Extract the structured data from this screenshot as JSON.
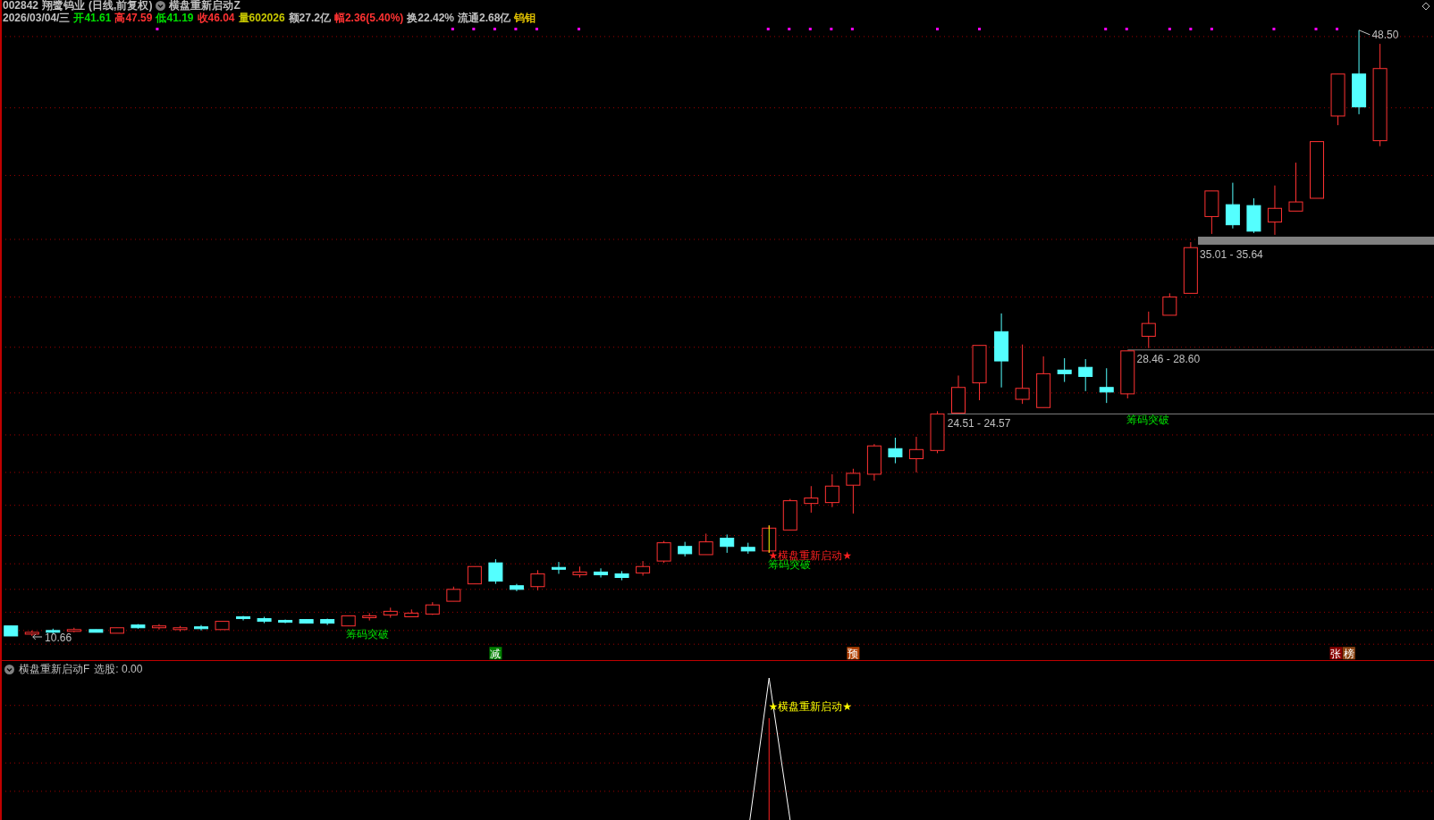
{
  "header": {
    "code": "002842",
    "name": "翔鹭钨业",
    "period": "(日线,前复权)",
    "indicator": "横盘重新启动Z"
  },
  "quote": [
    {
      "text": "2026/03/04/三",
      "color": "#c0c0c0"
    },
    {
      "text": "开41.61",
      "color": "#00e000"
    },
    {
      "text": "高47.59",
      "color": "#ff3232"
    },
    {
      "text": "低41.19",
      "color": "#00e000"
    },
    {
      "text": "收46.04",
      "color": "#ff3232"
    },
    {
      "text": "量602026",
      "color": "#c8c800"
    },
    {
      "text": "额27.2亿",
      "color": "#c0c0c0"
    },
    {
      "text": "幅2.36(5.40%)",
      "color": "#ff3232"
    },
    {
      "text": "换22.42%",
      "color": "#c0c0c0"
    },
    {
      "text": "流通2.68亿",
      "color": "#c0c0c0"
    },
    {
      "text": "钨钼",
      "color": "#e0c000"
    }
  ],
  "chart": {
    "high_label": "48.50",
    "low_label": "10.66",
    "zones": [
      "35.01 - 35.64",
      "28.46 - 28.60",
      "24.51 - 24.57"
    ],
    "signals": [
      {
        "text": "筹码突破",
        "kind": "chip"
      },
      {
        "text": "★横盘重新启动★",
        "kind": "restart"
      },
      {
        "text": "筹码突破",
        "kind": "chip"
      },
      {
        "text": "筹码突破",
        "kind": "chip"
      }
    ],
    "badges": [
      {
        "text": "减",
        "color": "#008000"
      },
      {
        "text": "预",
        "color": "#b04000"
      },
      {
        "text": "张",
        "color": "#8b0000"
      },
      {
        "text": "榜",
        "color": "#8b4513"
      }
    ]
  },
  "indicator": {
    "title": "横盘重新启动F",
    "reading": "选股: 0.00",
    "label": "★横盘重新启动★"
  }
}
